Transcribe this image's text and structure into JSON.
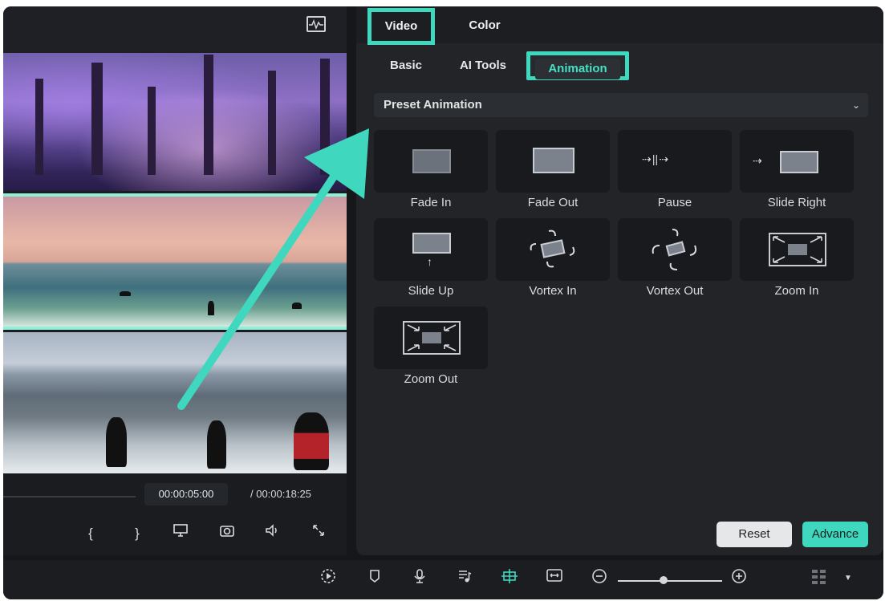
{
  "panel": {
    "tabs": [
      {
        "label": "Video",
        "active": true
      },
      {
        "label": "Color",
        "active": false
      }
    ],
    "subtabs": [
      {
        "label": "Basic"
      },
      {
        "label": "AI Tools"
      },
      {
        "label": "Animation",
        "active": true
      }
    ],
    "preset_label": "Preset Animation",
    "animations": [
      {
        "label": "Fade In",
        "icon": "fade-in-icon"
      },
      {
        "label": "Fade Out",
        "icon": "fade-out-icon"
      },
      {
        "label": "Pause",
        "icon": "pause-icon"
      },
      {
        "label": "Slide Right",
        "icon": "slide-right-icon"
      },
      {
        "label": "Slide Up",
        "icon": "slide-up-icon"
      },
      {
        "label": "Vortex In",
        "icon": "vortex-in-icon"
      },
      {
        "label": "Vortex Out",
        "icon": "vortex-out-icon"
      },
      {
        "label": "Zoom In",
        "icon": "zoom-in-icon"
      },
      {
        "label": "Zoom Out",
        "icon": "zoom-out-icon"
      }
    ],
    "reset_label": "Reset",
    "advance_label": "Advance"
  },
  "player": {
    "current_time": "00:00:05:00",
    "total_time": "/  00:00:18:25",
    "controls": [
      "{",
      "}"
    ]
  },
  "colors": {
    "accent": "#3fd7bd",
    "background": "#15171b",
    "panel": "#222428"
  }
}
